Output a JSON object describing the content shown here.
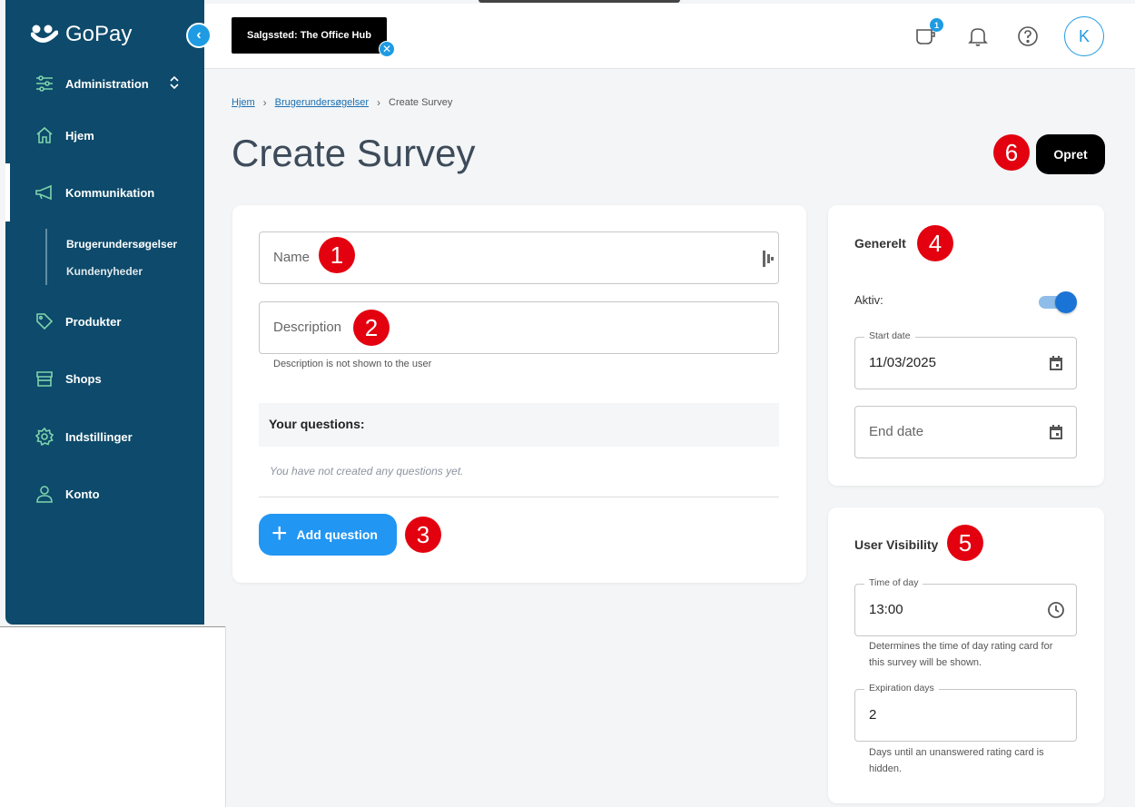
{
  "brand": {
    "name": "GoPay"
  },
  "sidebar": {
    "admin_label": "Administration",
    "items": [
      {
        "label": "Hjem",
        "icon": "home-icon"
      },
      {
        "label": "Kommunikation",
        "icon": "megaphone-icon"
      },
      {
        "label": "Produkter",
        "icon": "tag-icon"
      },
      {
        "label": "Shops",
        "icon": "shop-icon"
      },
      {
        "label": "Indstillinger",
        "icon": "gear-icon"
      },
      {
        "label": "Konto",
        "icon": "user-icon"
      }
    ],
    "subitems": [
      {
        "label": "Brugerundersøgelser"
      },
      {
        "label": "Kundenyheder"
      }
    ]
  },
  "topbar": {
    "sales_point": "Salgssted: The Office Hub",
    "notification_count": "1",
    "avatar_initial": "K"
  },
  "breadcrumb": {
    "home": "Hjem",
    "section": "Brugerundersøgelser",
    "current": "Create Survey"
  },
  "page": {
    "title": "Create Survey",
    "create_button": "Opret"
  },
  "form": {
    "name_placeholder": "Name",
    "description_placeholder": "Description",
    "description_hint": "Description is not shown to the user",
    "questions_heading": "Your questions:",
    "questions_empty": "You have not created any questions yet.",
    "add_question": "Add question"
  },
  "general": {
    "title": "Generelt",
    "active_label": "Aktiv:",
    "active_value": true,
    "start_date_label": "Start date",
    "start_date_value": "11/03/2025",
    "end_date_placeholder": "End date"
  },
  "visibility": {
    "title": "User Visibility",
    "time_label": "Time of day",
    "time_value": "13:00",
    "time_hint": "Determines the time of day rating card for this survey will be shown.",
    "expiration_label": "Expiration days",
    "expiration_value": "2",
    "expiration_hint": "Days until an unanswered rating card is hidden."
  },
  "markers": [
    "1",
    "2",
    "3",
    "4",
    "5",
    "6"
  ],
  "colors": {
    "sidebar": "#0d4a6b",
    "accent": "#2196f3",
    "icon_green": "#7fd3ac",
    "marker_red": "#e3000f"
  }
}
